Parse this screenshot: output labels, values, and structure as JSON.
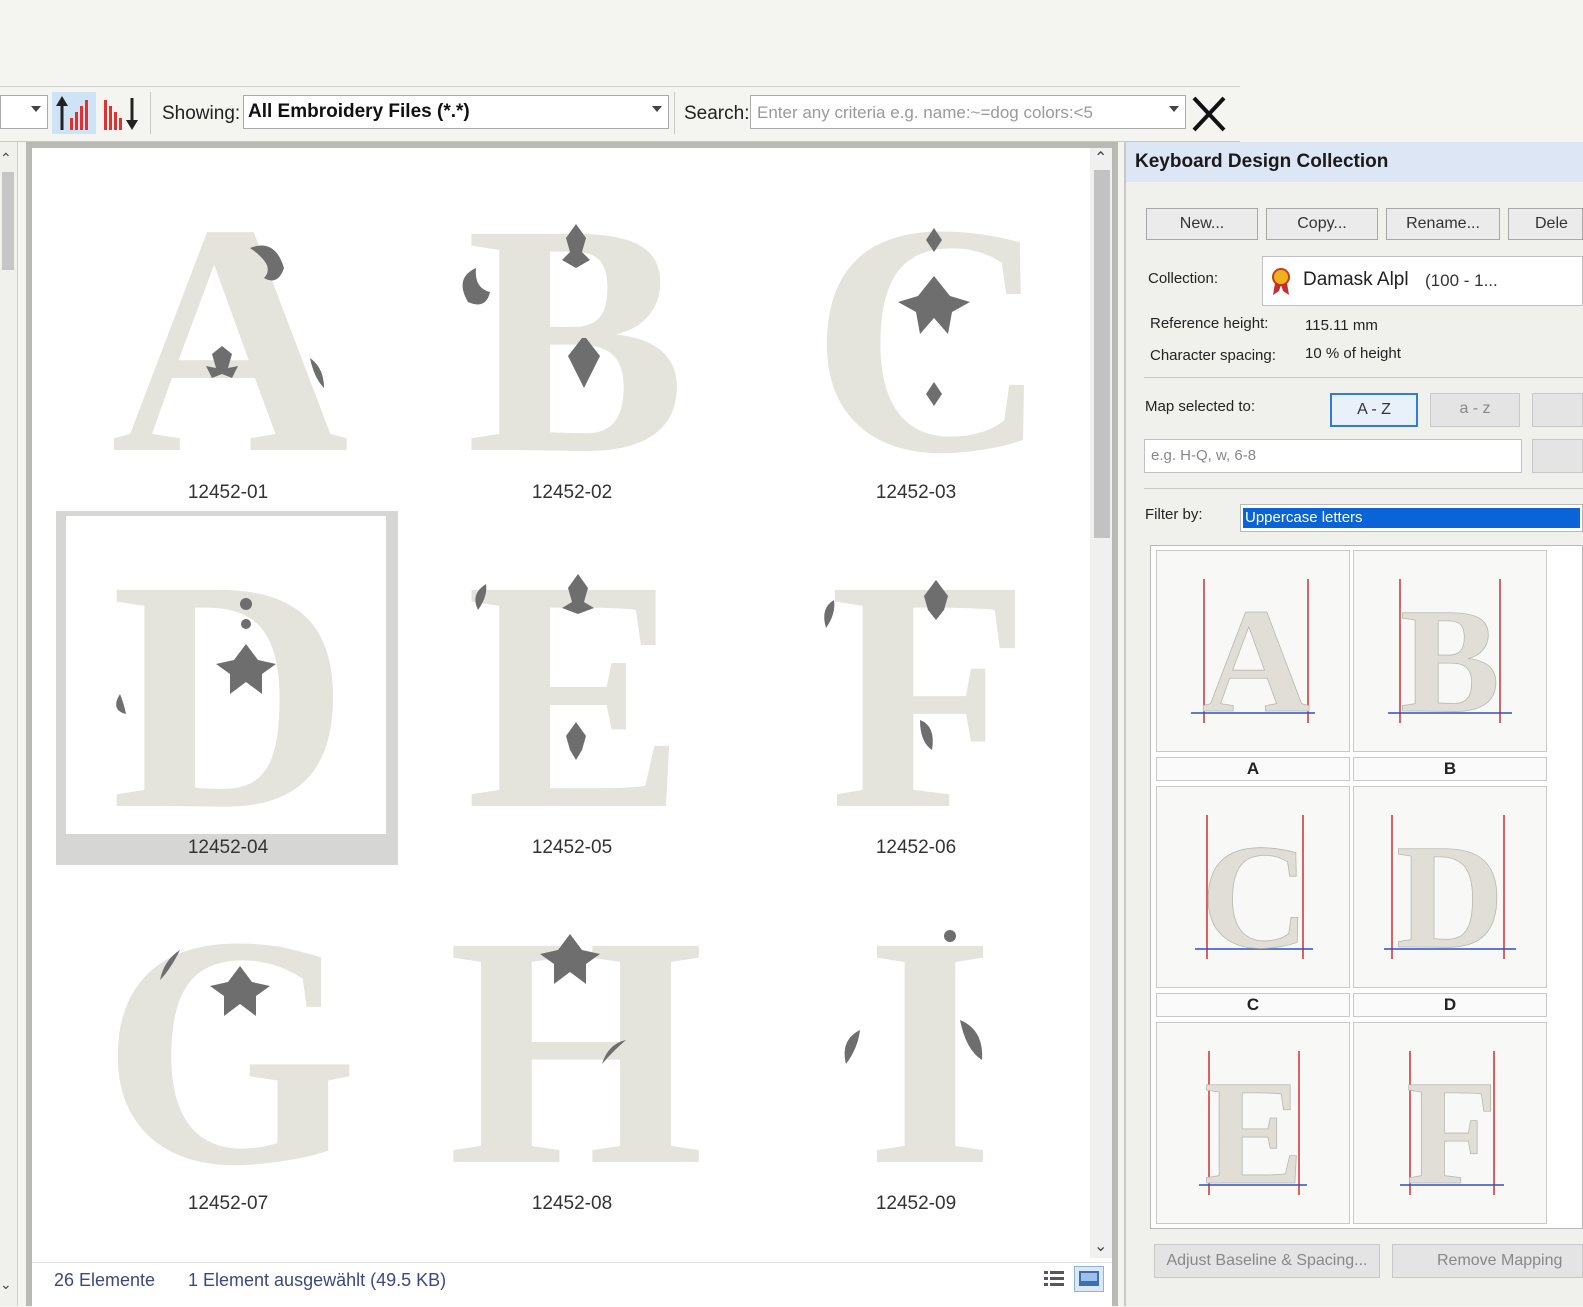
{
  "toolbar": {
    "showing_label": "Showing:",
    "showing_value": "All Embroidery Files (*.*)",
    "search_label": "Search:",
    "search_placeholder": "Enter any criteria e.g. name:~=dog colors:<5"
  },
  "files": [
    {
      "name": "12452-01",
      "letter": "A"
    },
    {
      "name": "12452-02",
      "letter": "B"
    },
    {
      "name": "12452-03",
      "letter": "C"
    },
    {
      "name": "12452-04",
      "letter": "D",
      "selected": true
    },
    {
      "name": "12452-05",
      "letter": "E"
    },
    {
      "name": "12452-06",
      "letter": "F"
    },
    {
      "name": "12452-07",
      "letter": "G"
    },
    {
      "name": "12452-08",
      "letter": "H"
    },
    {
      "name": "12452-09",
      "letter": "I"
    }
  ],
  "status": {
    "count": "26 Elemente",
    "selection": "1 Element ausgewählt (49.5 KB)"
  },
  "panel": {
    "title": "Keyboard Design Collection",
    "buttons": {
      "new": "New...",
      "copy": "Copy...",
      "rename": "Rename...",
      "delete": "Dele"
    },
    "collection_label": "Collection:",
    "collection_name": "Damask Alpl",
    "collection_range": "(100 - 1...",
    "ref_height_label": "Reference height:",
    "ref_height_value": "115.11 mm",
    "char_spacing_label": "Character spacing:",
    "char_spacing_value": "10 % of height",
    "map_label": "Map selected to:",
    "map_upper": "A - Z",
    "map_lower": "a - z",
    "map_placeholder": "e.g. H-Q, w, 6-8",
    "filter_label": "Filter by:",
    "filter_value": "Uppercase letters",
    "grid_letters": [
      "A",
      "B",
      "C",
      "D",
      "",
      ""
    ],
    "adjust_button": "Adjust Baseline & Spacing...",
    "remove_button": "Remove Mapping"
  },
  "colors": {
    "accent": "#0a64d8",
    "fill": "#e4e4dc",
    "motif": "#6e6e6e"
  }
}
